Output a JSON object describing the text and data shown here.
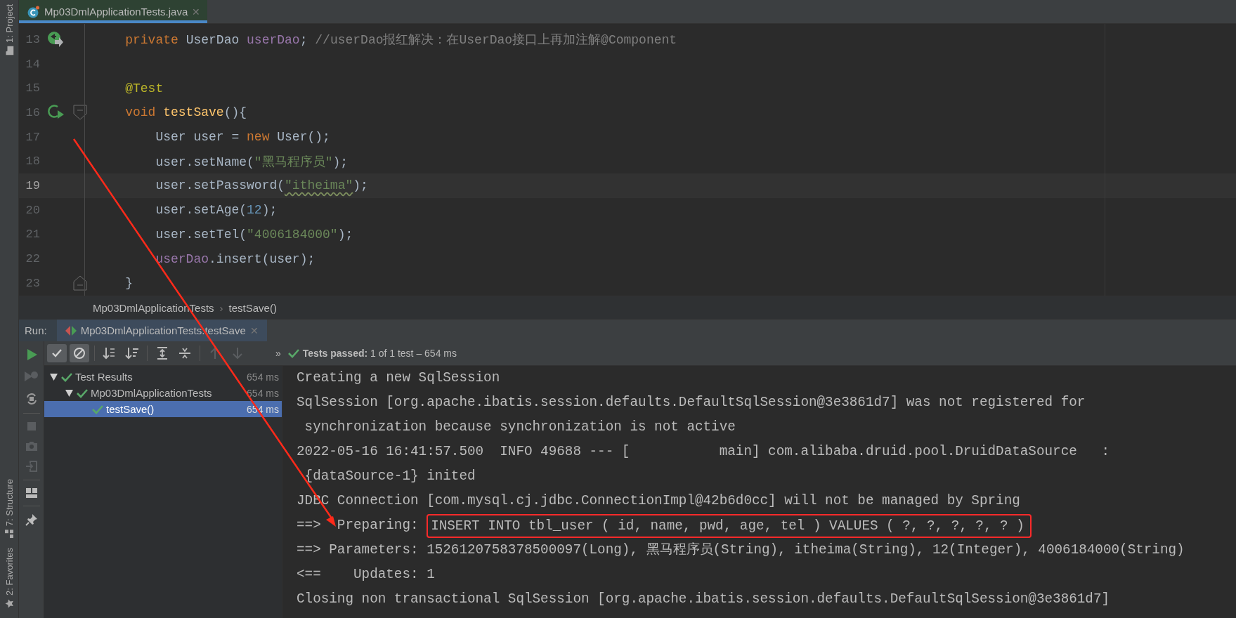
{
  "side_tools_top": [
    {
      "label": "1: Project",
      "kind": "project"
    }
  ],
  "side_tools_bottom": [
    {
      "label": "7: Structure",
      "kind": "structure"
    },
    {
      "label": "2: Favorites",
      "kind": "favorites"
    }
  ],
  "editor_tabs": [
    {
      "label": "Mp03DmlApplicationTests.java",
      "close": "✕",
      "selected": true
    }
  ],
  "editor": {
    "lines": [
      {
        "number": "13",
        "current": false,
        "kind": "class_run",
        "tokens": [
          {
            "text": "    private ",
            "kind": "keyword"
          },
          {
            "text": "UserDao ",
            "kind": "plain"
          },
          {
            "text": "userDao",
            "kind": "field"
          },
          {
            "text": "; ",
            "kind": "plain"
          },
          {
            "text": "//userDao报红解决：在UserDao接口上再加注解@Component",
            "kind": "comment"
          }
        ]
      },
      {
        "number": "14",
        "current": false,
        "kind": "code"
      },
      {
        "number": "15",
        "current": false,
        "kind": "code",
        "tokens": [
          {
            "text": "    @Test",
            "kind": "annotation"
          }
        ]
      },
      {
        "number": "16",
        "current": false,
        "kind": "method_start",
        "tokens": [
          {
            "text": "    void ",
            "kind": "keyword"
          },
          {
            "text": "testSave",
            "kind": "method"
          },
          {
            "text": "(){",
            "kind": "plain"
          }
        ]
      },
      {
        "number": "17",
        "current": false,
        "kind": "code",
        "tokens": [
          {
            "text": "        User user = ",
            "kind": "plain"
          },
          {
            "text": "new ",
            "kind": "keyword"
          },
          {
            "text": "User();",
            "kind": "plain"
          }
        ]
      },
      {
        "number": "18",
        "current": false,
        "kind": "code",
        "tokens": [
          {
            "text": "        user.setName(",
            "kind": "plain"
          },
          {
            "text": "\"黑马程序员\"",
            "kind": "string"
          },
          {
            "text": ");",
            "kind": "plain"
          }
        ]
      },
      {
        "number": "19",
        "current": true,
        "kind": "code",
        "tokens": [
          {
            "text": "        user.setPassword(",
            "kind": "plain"
          },
          {
            "text": "\"itheima\"",
            "kind": "string_typo"
          },
          {
            "text": ");",
            "kind": "plain"
          }
        ]
      },
      {
        "number": "20",
        "current": false,
        "kind": "code",
        "tokens": [
          {
            "text": "        user.setAge(",
            "kind": "plain"
          },
          {
            "text": "12",
            "kind": "number"
          },
          {
            "text": ");",
            "kind": "plain"
          }
        ]
      },
      {
        "number": "21",
        "current": false,
        "kind": "code",
        "tokens": [
          {
            "text": "        user.setTel(",
            "kind": "plain"
          },
          {
            "text": "\"4006184000\"",
            "kind": "string"
          },
          {
            "text": ");",
            "kind": "plain"
          }
        ]
      },
      {
        "number": "22",
        "current": false,
        "kind": "code",
        "tokens": [
          {
            "text": "        userDao",
            "kind": "field"
          },
          {
            "text": ".insert(user);",
            "kind": "plain"
          }
        ]
      },
      {
        "number": "23",
        "current": false,
        "kind": "block_end",
        "tokens": [
          {
            "text": "    }",
            "kind": "plain"
          }
        ]
      }
    ]
  },
  "breadcrumb": {
    "items": [
      "Mp03DmlApplicationTests",
      "testSave()"
    ],
    "separator": "›"
  },
  "run_panel": {
    "label": "Run:",
    "tab": {
      "label": "Mp03DmlApplicationTests.testSave",
      "close": "✕",
      "selected": true
    },
    "toggles": [
      {
        "kind": "passed",
        "selected": true
      },
      {
        "kind": "ignored",
        "selected": true
      }
    ],
    "overflow": "»",
    "status": "**Tests passed:** 1 of 1 test – 654 ms",
    "tree": [
      {
        "label": "Test Results",
        "time": "654 ms",
        "expanded": true,
        "selected": false,
        "children": [
          {
            "label": "Mp03DmlApplicationTests",
            "time": "654 ms",
            "expanded": true,
            "selected": false,
            "children": [
              {
                "label": "testSave()",
                "time": "654 ms",
                "selected": true
              }
            ]
          }
        ]
      }
    ],
    "console": [
      {
        "text": "Creating a new SqlSession"
      },
      {
        "text": "SqlSession [org.apache.ibatis.session.defaults.DefaultSqlSession@3e3861d7] was not registered for"
      },
      {
        "text": " synchronization because synchronization is not active"
      },
      {
        "text": "2022-05-16 16:41:57.500  INFO 49688 --- [           main] com.alibaba.druid.pool.DruidDataSource   :"
      },
      {
        "text": " {dataSource-1} inited"
      },
      {
        "text": "JDBC Connection [com.mysql.cj.jdbc.ConnectionImpl@42b6d0cc] will not be managed by Spring"
      },
      {
        "text": "==>  Preparing: ",
        "boxed": "INSERT INTO tbl_user ( id, name, pwd, age, tel ) VALUES ( ?, ?, ?, ?, ? )"
      },
      {
        "text": "==> Parameters: 1526120758378500097(Long), 黑马程序员(String), itheima(String), 12(Integer), 4006184000(String)"
      },
      {
        "text": "<==    Updates: 1"
      },
      {
        "text": "Closing non transactional SqlSession [org.apache.ibatis.session.defaults.DefaultSqlSession@3e3861d7]"
      }
    ]
  },
  "overlays": [
    {
      "kind": "arrow"
    }
  ]
}
